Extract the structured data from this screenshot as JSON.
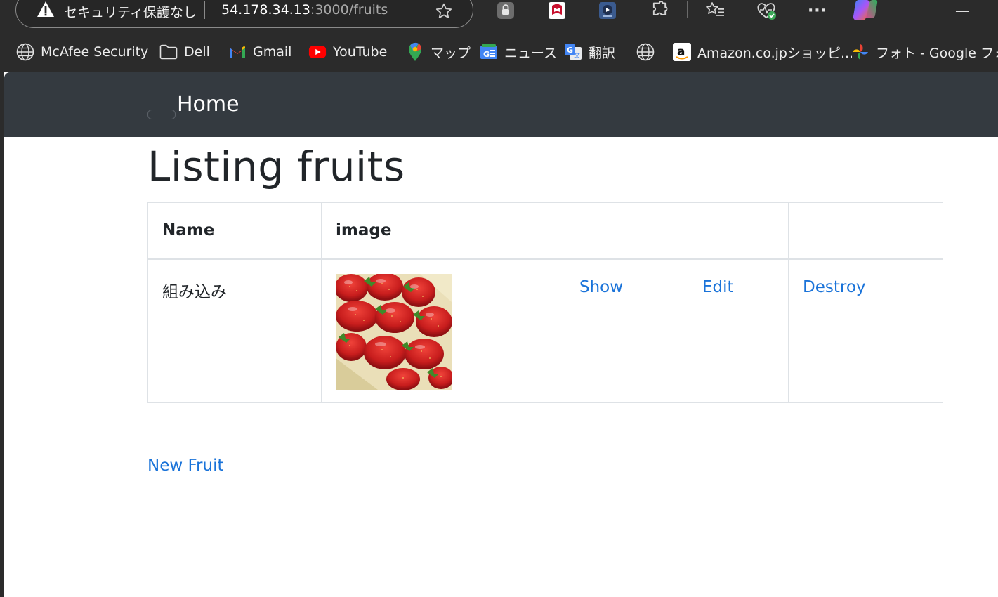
{
  "browser": {
    "security_label": "セキュリティ保護なし",
    "url_host": "54.178.34.13",
    "url_path": ":3000/fruits",
    "minimize_symbol": "—",
    "more_symbol": "···",
    "bookmarks": [
      {
        "label": "McAfee Security",
        "icon": "globe-icon"
      },
      {
        "label": "Dell",
        "icon": "folder-icon"
      },
      {
        "label": "Gmail",
        "icon": "gmail-icon"
      },
      {
        "label": "YouTube",
        "icon": "youtube-icon"
      },
      {
        "label": "マップ",
        "icon": "maps-pin-icon"
      },
      {
        "label": "ニュース",
        "icon": "news-icon"
      },
      {
        "label": "翻訳",
        "icon": "translate-icon"
      },
      {
        "label": "",
        "icon": "globe-icon"
      },
      {
        "label": "Amazon.co.jpショッピ...",
        "icon": "amazon-icon"
      },
      {
        "label": "フォト - Google フォト",
        "icon": "photos-pinwheel-icon"
      }
    ]
  },
  "navbar": {
    "brand": "Home"
  },
  "page": {
    "title": "Listing fruits",
    "new_link": "New Fruit"
  },
  "table": {
    "headers": [
      "Name",
      "image",
      "",
      "",
      ""
    ],
    "rows": [
      {
        "name": "組み込み",
        "image": "strawberries-photo",
        "actions": [
          "Show",
          "Edit",
          "Destroy"
        ]
      }
    ]
  },
  "colors": {
    "navbar": "#343a40",
    "link": "#1a73d9",
    "chrome": "#2b2b2b"
  }
}
